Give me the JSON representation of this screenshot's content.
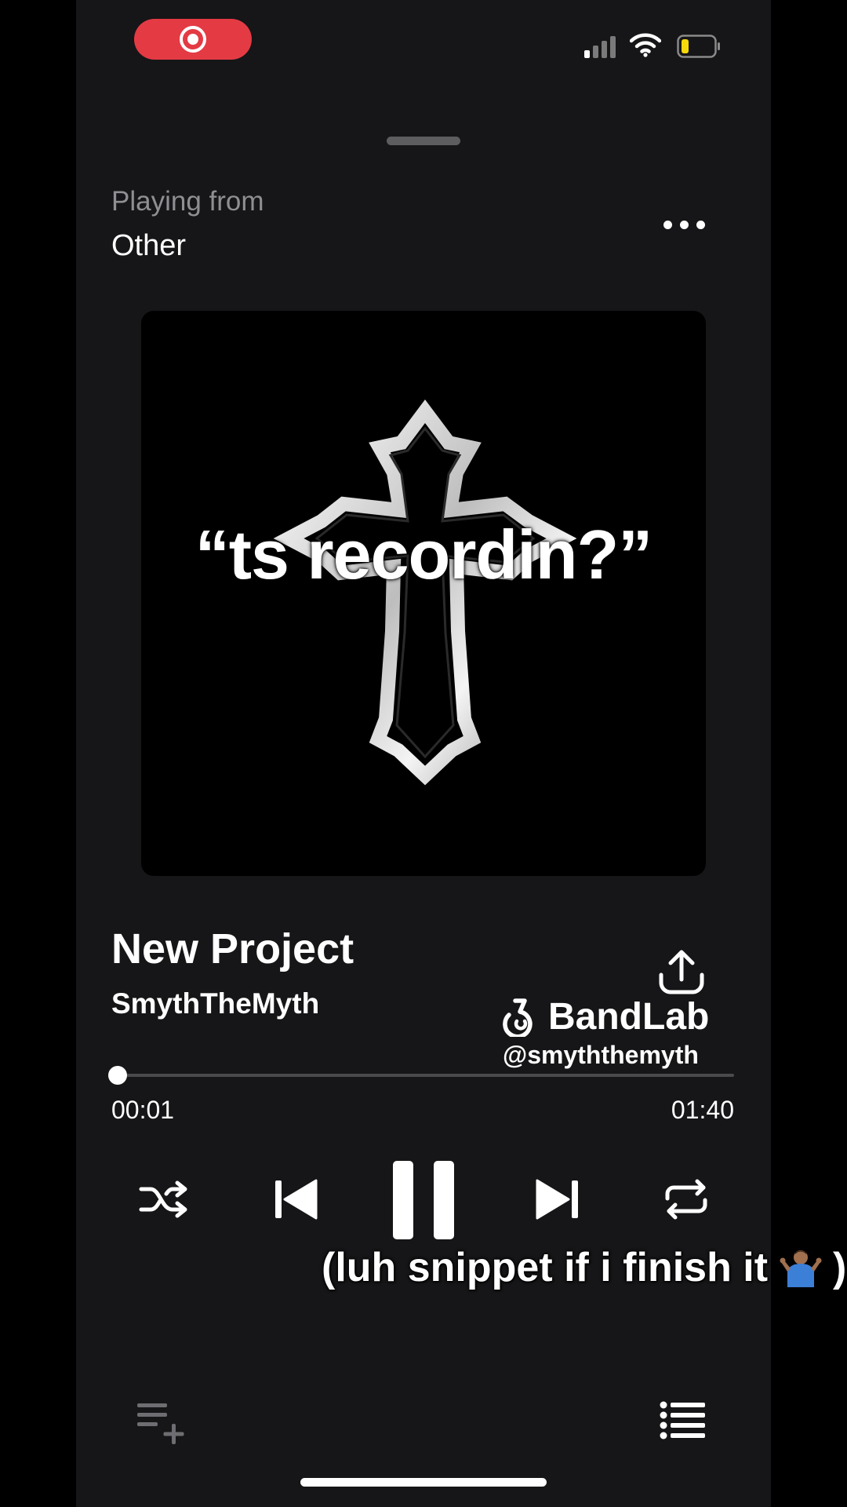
{
  "status_bar": {
    "record_icon": "record-icon",
    "signal_icon": "cellular-signal-icon",
    "wifi_icon": "wifi-icon",
    "battery_icon": "battery-low-icon",
    "battery_level": 0.2,
    "colors": {
      "record": "#e43a44",
      "battery_fill": "#f5d90a"
    }
  },
  "header": {
    "playing_from_label": "Playing from",
    "source_name": "Other",
    "more_icon": "more-horizontal-icon"
  },
  "artwork": {
    "caption": "“ts recordin?”",
    "art_icon": "cross-icon"
  },
  "track": {
    "title": "New Project",
    "artist": "SmythTheMyth",
    "share_icon": "share-icon"
  },
  "watermark": {
    "brand": "BandLab",
    "handle": "@smyththemyth",
    "logo_icon": "bandlab-logo-icon"
  },
  "progress": {
    "elapsed": "00:01",
    "total": "01:40",
    "fraction": 0.01
  },
  "controls": {
    "shuffle_icon": "shuffle-icon",
    "previous_icon": "skip-previous-icon",
    "pause_icon": "pause-icon",
    "next_icon": "skip-next-icon",
    "repeat_icon": "repeat-icon"
  },
  "overlay_caption": {
    "text": "(luh snippet if i finish it",
    "close": ")",
    "emoji_icon": "shrug-emoji-icon"
  },
  "footer": {
    "add_to_queue_icon": "add-to-queue-icon",
    "queue_icon": "queue-list-icon"
  },
  "colors": {
    "background": "#161517",
    "outer": "#000000",
    "secondary_text": "#8f8f93"
  }
}
